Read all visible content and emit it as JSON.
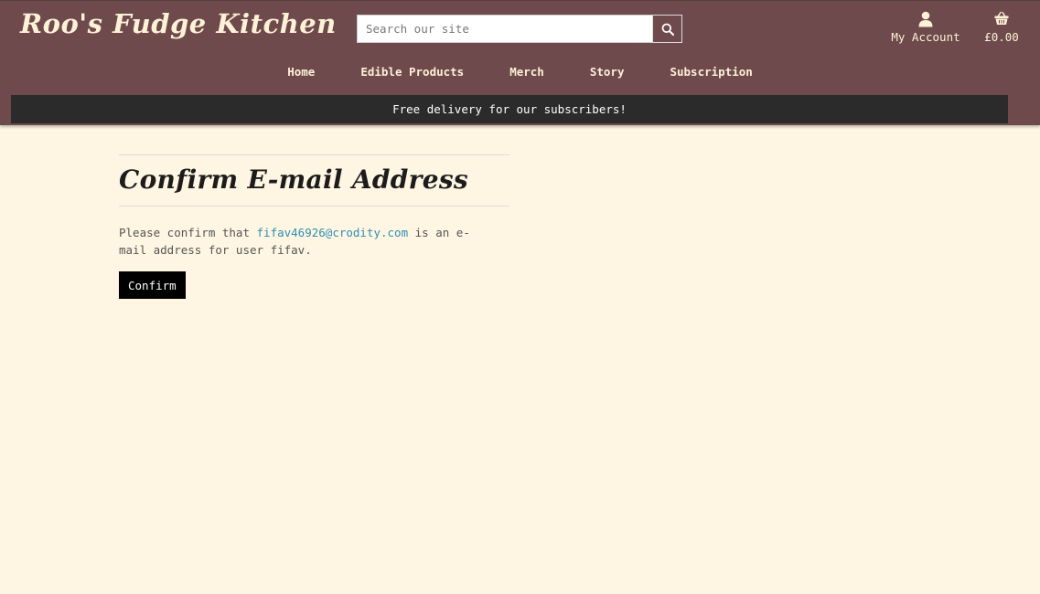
{
  "site": {
    "logo_text": "Roo's Fudge Kitchen"
  },
  "search": {
    "placeholder": "Search our site",
    "icon": "magnifier-icon"
  },
  "account": {
    "label": "My Account",
    "icon": "user-icon"
  },
  "basket": {
    "total": "£0.00",
    "icon": "basket-icon"
  },
  "nav": {
    "items": [
      "Home",
      "Edible Products",
      "Merch",
      "Story",
      "Subscription"
    ]
  },
  "banner": {
    "text": "Free delivery for our subscribers!"
  },
  "main": {
    "title": "Confirm E-mail Address",
    "message_before": "Please confirm that",
    "email": "fifav46926@crodity.com",
    "message_after": "is an e-mail address for user fifav.",
    "confirm_label": "Confirm"
  },
  "colors": {
    "header": "#6e4a4c",
    "banner": "#2b2b2b",
    "background": "#fef6e2",
    "link": "#2f8fb3",
    "accent_text": "#fdf1d6"
  }
}
